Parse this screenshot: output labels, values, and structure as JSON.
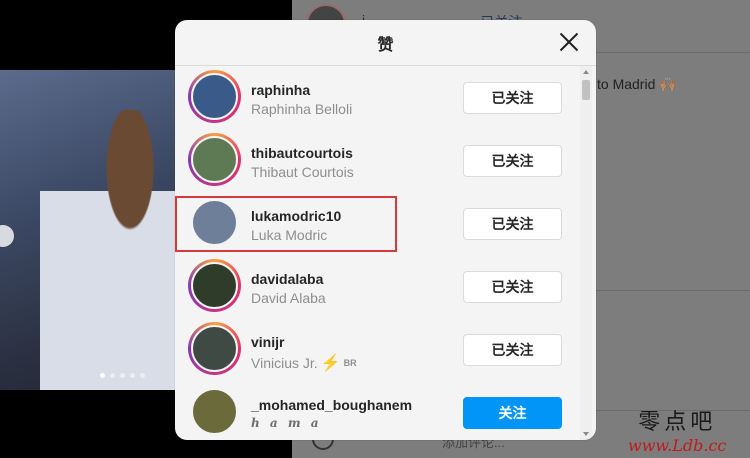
{
  "background": {
    "profile_name": "i",
    "follow_text": "· 已关注",
    "caption": "to Madrid 🙌🏽",
    "comment_placeholder": "添加评论..."
  },
  "modal": {
    "title": "赞",
    "users": [
      {
        "username": "raphinha",
        "full_name": "Raphinha Belloli",
        "button": "已关注",
        "state": "following",
        "avatar_color": "#3a5a8a",
        "story_ring": true
      },
      {
        "username": "thibautcourtois",
        "full_name": "Thibaut Courtois",
        "button": "已关注",
        "state": "following",
        "avatar_color": "#5d7a55",
        "story_ring": true
      },
      {
        "username": "lukamodric10",
        "full_name": "Luka Modric",
        "button": "已关注",
        "state": "following",
        "avatar_color": "#6e7f9a",
        "story_ring": false
      },
      {
        "username": "davidalaba",
        "full_name": "David Alaba",
        "button": "已关注",
        "state": "following",
        "avatar_color": "#2f3c2a",
        "story_ring": true
      },
      {
        "username": "vinijr",
        "full_name": "Vinicius Jr.",
        "badge": "BR",
        "button": "已关注",
        "state": "following",
        "avatar_color": "#3f4a45",
        "story_ring": true
      },
      {
        "username": "_mohamed_boughanem",
        "full_name": "h a m a",
        "button": "关注",
        "state": "follow",
        "avatar_color": "#6a6a3a",
        "story_ring": false
      }
    ]
  },
  "watermark": {
    "chinese": "零点吧",
    "url": "www.Ldb.cc"
  },
  "colors": {
    "accent": "#0095f6",
    "highlight": "#d43a3a"
  }
}
